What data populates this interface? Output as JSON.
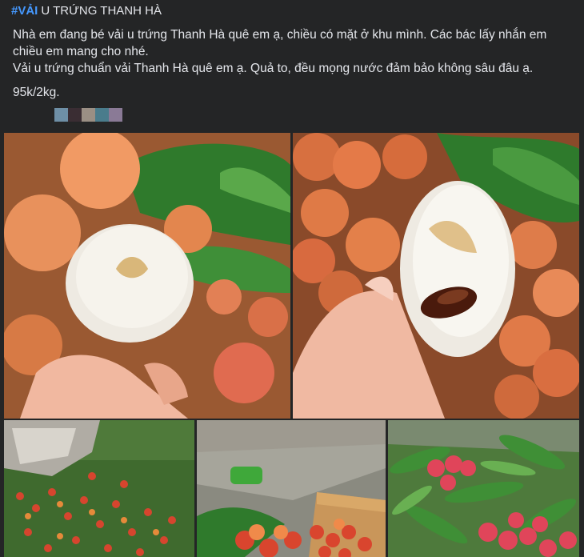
{
  "post": {
    "hashtag": "#VẢI",
    "title": "U TRỨNG THANH HÀ",
    "paragraph1": "Nhà em đang bé vải u trứng Thanh Hà quê em ạ, chiều  có mặt ở khu mình. Các bác lấy nhắn em chiều em mang cho nhé.",
    "paragraph2": "Vải u trứng chuẩn vải Thanh Hà quê em ạ. Quả to, đều mọng nước đảm bảo không sâu đâu ạ.",
    "price": "95k/2kg."
  },
  "colors": {
    "background": "#242526",
    "hashtag": "#4599ff",
    "text": "#e4e6eb",
    "swatches": [
      "#6e8fa6",
      "#3a2d33",
      "#9a8f84",
      "#4a7c8c",
      "#8a7a96"
    ]
  },
  "photos": [
    {
      "name": "photo-peeled-lychee-hand",
      "desc_icon": "lychee-photo"
    },
    {
      "name": "photo-lychee-with-seed",
      "desc_icon": "lychee-photo"
    },
    {
      "name": "photo-lychee-orchard",
      "desc_icon": "lychee-photo"
    },
    {
      "name": "photo-lychee-box",
      "desc_icon": "lychee-photo"
    },
    {
      "name": "photo-lychee-branch",
      "desc_icon": "lychee-photo"
    }
  ]
}
